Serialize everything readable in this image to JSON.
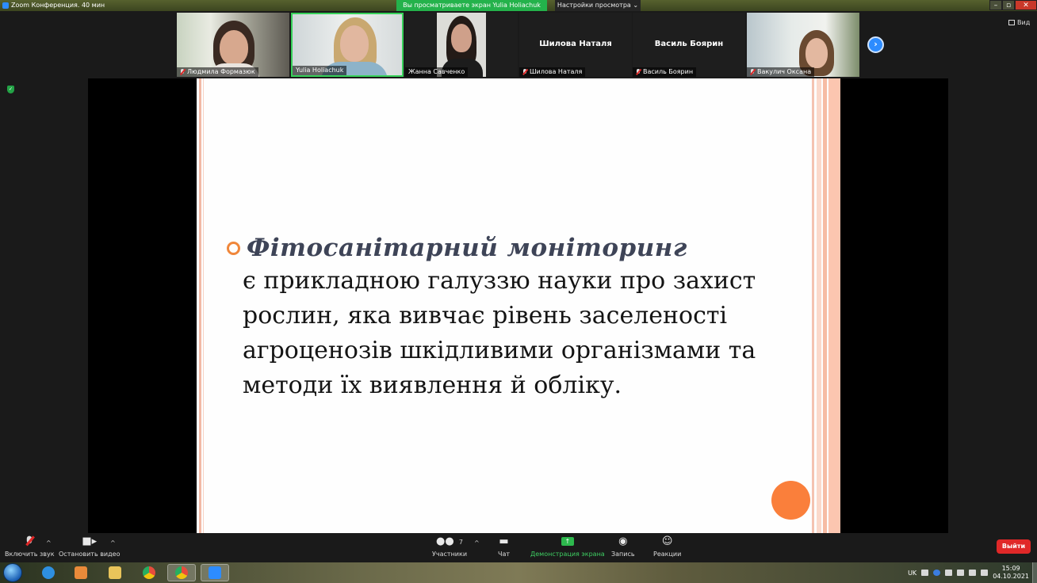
{
  "window": {
    "title": "Zoom Конференция. 40 мин"
  },
  "share_banner": {
    "text": "Вы просматриваете экран Yulia Holiachuk"
  },
  "view_options": {
    "label": "Настройки просмотра ⌄"
  },
  "view_button": {
    "label": "Вид"
  },
  "participants": [
    {
      "name": "Людмила Формазюк",
      "muted": true,
      "video": true
    },
    {
      "name": "Yulia Holiachuk",
      "muted": false,
      "video": true
    },
    {
      "name": "Жанна Савченко",
      "muted": false,
      "video": true
    },
    {
      "name": "Шилова Наталя",
      "muted": true,
      "video": false
    },
    {
      "name": "Василь Боярин",
      "muted": true,
      "video": false
    },
    {
      "name": "Вакулич Оксана",
      "muted": true,
      "video": true
    }
  ],
  "slide": {
    "title": "Фітосанітарний моніторинг",
    "body_lines": [
      "є прикладною галуззю науки про захист",
      "рослин, яка вивчає рівень заселеності",
      "агроценозів шкідливими організмами та",
      "методи їх виявлення й обліку."
    ]
  },
  "toolbar": {
    "unmute": "Включить звук",
    "stop_video": "Остановить видео",
    "participants": "Участники",
    "participants_count": "7",
    "chat": "Чат",
    "share_screen": "Демонстрация экрана",
    "record": "Запись",
    "reactions": "Реакции",
    "leave": "Выйти"
  },
  "taskbar": {
    "language": "UK",
    "time": "15:09",
    "date": "04.10.2021"
  },
  "colors": {
    "accent_orange": "#fa7f3b",
    "share_green": "#24b24b",
    "zoom_blue": "#2d8cff",
    "leave_red": "#e02828"
  }
}
